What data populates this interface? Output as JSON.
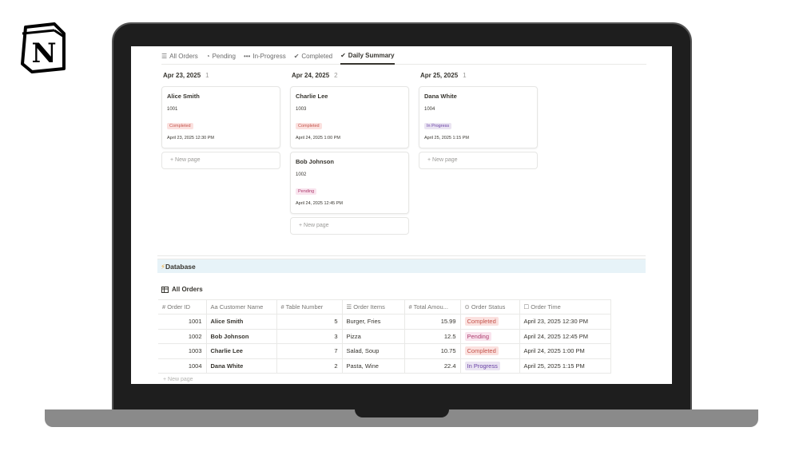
{
  "logo": {
    "letter": "N"
  },
  "tabs": [
    {
      "icon": "list-icon",
      "glyph": "☰",
      "label": "All Orders"
    },
    {
      "icon": "pending-icon",
      "glyph": "◔",
      "label": "Pending"
    },
    {
      "icon": "ellipsis-icon",
      "glyph": "•••",
      "label": "In-Progress"
    },
    {
      "icon": "check-circle-icon",
      "glyph": "✔",
      "label": "Completed"
    },
    {
      "icon": "check-circle-icon",
      "glyph": "✔",
      "label": "Daily Summary"
    }
  ],
  "board": {
    "new_page_label": "+  New page",
    "columns": [
      {
        "date": "Apr 23, 2025",
        "count": "1",
        "cards": [
          {
            "name": "Alice Smith",
            "id": "1001",
            "status": "Completed",
            "time": "April 23, 2025 12:30 PM"
          }
        ]
      },
      {
        "date": "Apr 24, 2025",
        "count": "2",
        "cards": [
          {
            "name": "Charlie Lee",
            "id": "1003",
            "status": "Completed",
            "time": "April 24, 2025 1:00 PM"
          },
          {
            "name": "Bob Johnson",
            "id": "1002",
            "status": "Pending",
            "time": "April 24, 2025 12:45 PM"
          }
        ]
      },
      {
        "date": "Apr 25, 2025",
        "count": "1",
        "cards": [
          {
            "name": "Dana White",
            "id": "1004",
            "status": "In Progress",
            "time": "April 25, 2025 1:15 PM"
          }
        ]
      }
    ]
  },
  "database": {
    "title": "Database",
    "view_label": "All Orders",
    "new_page_label": "+  New page",
    "columns": [
      "# Order ID",
      "Aa Customer Name",
      "# Table Number",
      "☰ Order Items",
      "# Total Amou...",
      "⊙ Order Status",
      "☐ Order Time"
    ],
    "rows": [
      {
        "id": "1001",
        "name": "Alice Smith",
        "table": "5",
        "items": "Burger, Fries",
        "total": "15.99",
        "status": "Completed",
        "time": "April 23, 2025 12:30 PM"
      },
      {
        "id": "1002",
        "name": "Bob Johnson",
        "table": "3",
        "items": "Pizza",
        "total": "12.5",
        "status": "Pending",
        "time": "April 24, 2025 12:45 PM"
      },
      {
        "id": "1003",
        "name": "Charlie Lee",
        "table": "7",
        "items": "Salad, Soup",
        "total": "10.75",
        "status": "Completed",
        "time": "April 24, 2025 1:00 PM"
      },
      {
        "id": "1004",
        "name": "Dana White",
        "table": "2",
        "items": "Pasta, Wine",
        "total": "22.4",
        "status": "In Progress",
        "time": "April 25, 2025 1:15 PM"
      }
    ]
  },
  "colors": {
    "completed": "#c4554d",
    "pending": "#ad3a6d",
    "in_progress": "#6940a5",
    "database_bar": "#e7f3f8"
  }
}
